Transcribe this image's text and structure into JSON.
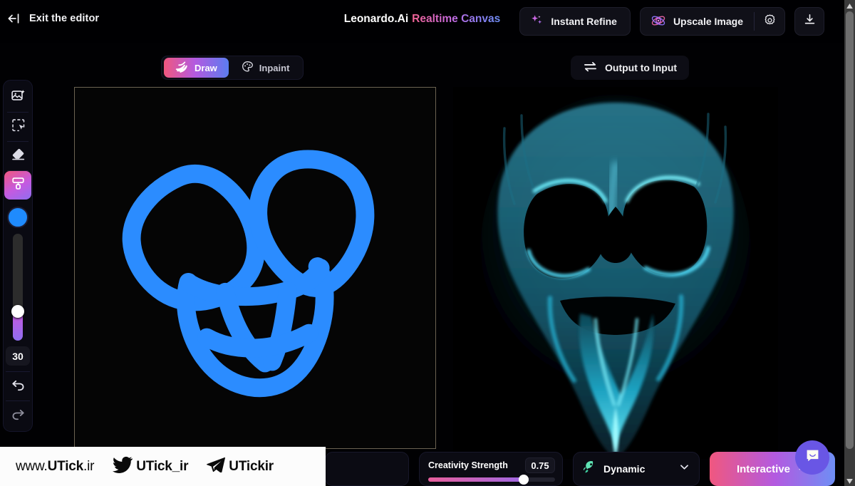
{
  "header": {
    "exit_label": "Exit the editor",
    "exit_icon": "arrow-left-to-bar-icon",
    "brand_name": "Leonardo.Ai",
    "brand_product": "Realtime Canvas",
    "instant_refine_label": "Instant Refine",
    "instant_refine_icon": "sparkles-icon",
    "upscale_label": "Upscale Image",
    "upscale_icon": "atom-orbit-icon",
    "settings_icon": "gear-icon",
    "download_icon": "download-icon"
  },
  "tabs": {
    "items": [
      {
        "label": "Draw",
        "icon": "brush-stroke-icon",
        "active": true
      },
      {
        "label": "Inpaint",
        "icon": "palette-icon",
        "active": false
      }
    ],
    "output_to_input_label": "Output to Input",
    "output_to_input_icon": "swap-arrows-icon"
  },
  "toolbar": {
    "tools": [
      {
        "name": "image-generate-icon",
        "active": false
      },
      {
        "name": "select-marquee-icon",
        "active": false
      },
      {
        "name": "eraser-icon",
        "active": false
      },
      {
        "name": "paintbrush-icon",
        "active": true
      }
    ],
    "brush_color": "#1f8bfd",
    "brush_size": "30",
    "undo_icon": "undo-icon",
    "redo_icon": "redo-icon"
  },
  "canvas": {
    "draw_stroke_color": "#2b8cff",
    "draw_background": "#050505",
    "output_background": "#000000",
    "output_glow_color": "#29d2f0",
    "output_description": "glowing cyan skull"
  },
  "bottom_bar": {
    "creativity_label": "Creativity Strength",
    "creativity_value": "0.75",
    "preset_label": "Dynamic",
    "preset_icon": "rocket-icon",
    "preset_chevron_icon": "chevron-down-icon",
    "interactive_label": "Interactive",
    "interactive_chevron_icon": "chevron-up-icon"
  },
  "chat": {
    "icon": "chat-bubble-icon",
    "color": "#6956e5"
  },
  "watermark": {
    "site": "www.UTick.ir",
    "site_prefix": "www.",
    "site_main": "UTick",
    "site_suffix": ".ir",
    "twitter_handle": "UTick_ir",
    "twitter_icon": "twitter-bird-icon",
    "telegram_handle": "UTickir",
    "telegram_icon": "telegram-plane-icon"
  },
  "scrollbar": {
    "up_icon": "scroll-up-arrow-icon",
    "down_icon": "scroll-down-arrow-icon"
  }
}
